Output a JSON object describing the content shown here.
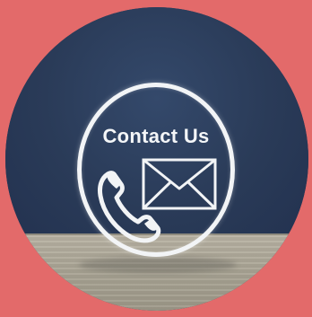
{
  "badge": {
    "title": "Contact Us",
    "icons": [
      "phone-icon",
      "envelope-icon"
    ]
  },
  "colors": {
    "background": "#e36a6a",
    "disc": "#2b3d5a",
    "floor": "#a8a393",
    "ring": "#f2f4f6"
  }
}
